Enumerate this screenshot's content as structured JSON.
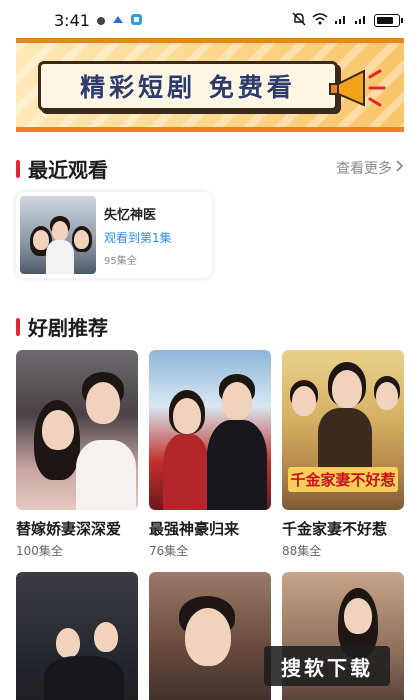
{
  "status_bar": {
    "time": "3:41",
    "icons": [
      "notification-dot-icon",
      "app-icon",
      "app-icon",
      "mute-icon",
      "wifi-icon",
      "signal-icon",
      "signal-icon",
      "battery-icon"
    ],
    "battery_level": 0.85
  },
  "banner": {
    "text": "精彩短剧 免费看",
    "icon": "megaphone-icon"
  },
  "recent": {
    "section_title": "最近观看",
    "see_more": "查看更多",
    "item": {
      "name": "失忆神医",
      "progress": "观看到第1集",
      "total": "95集全"
    }
  },
  "recommend": {
    "section_title": "好剧推荐",
    "items": [
      {
        "title": "替嫁娇妻深深爱",
        "episodes": "100集全"
      },
      {
        "title": "最强神豪归来",
        "episodes": "76集全"
      },
      {
        "title": "千金家妻不好惹",
        "episodes": "88集全",
        "poster_text": "千金家妻不好惹"
      },
      {
        "title": "",
        "episodes": ""
      },
      {
        "title": "",
        "episodes": ""
      },
      {
        "title": "",
        "episodes": ""
      }
    ]
  },
  "watermark": "搜软下载",
  "colors": {
    "accent": "#e0262f",
    "link": "#2b8ee6",
    "banner_border": "#e8851c"
  }
}
